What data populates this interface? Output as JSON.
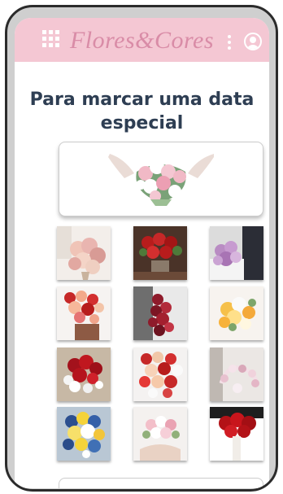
{
  "appbar": {
    "brand": "Flores&Cores",
    "menu_icon": "grid-icon",
    "options_icon": "kebab-icon",
    "account_icon": "account-icon"
  },
  "section": {
    "title": "Para marcar uma data especial"
  },
  "colors": {
    "appbar": "#f4c7d3",
    "brand": "#d98ca7",
    "title": "#2e3e53"
  },
  "featured": {
    "image": "bridal-bouquet-pink-white"
  },
  "gallery": [
    {
      "image": "bouquet-pastel-roses"
    },
    {
      "image": "bouquet-red-roses"
    },
    {
      "image": "bouquet-purple-bride"
    },
    {
      "image": "bouquet-red-peach"
    },
    {
      "image": "bouquet-dark-red"
    },
    {
      "image": "bouquet-yellow-white"
    },
    {
      "image": "bouquet-red-babys-breath"
    },
    {
      "image": "bouquet-red-peach-white"
    },
    {
      "image": "bouquet-white-orchids"
    },
    {
      "image": "bouquet-blue-yellow"
    },
    {
      "image": "bouquet-pink-white-bride"
    },
    {
      "image": "bouquet-red-roses-bride"
    }
  ]
}
